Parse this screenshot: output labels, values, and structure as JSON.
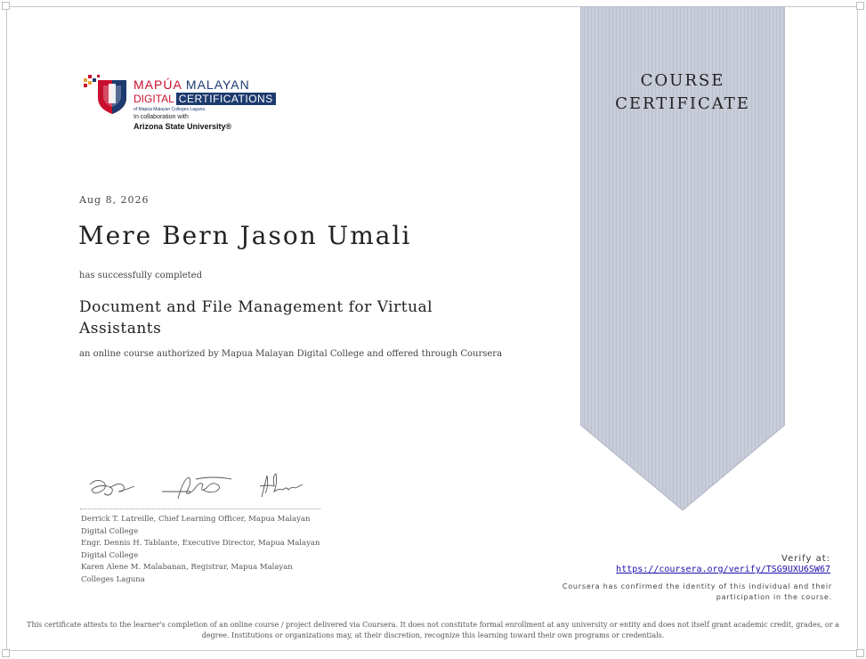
{
  "ribbon": {
    "line1": "COURSE",
    "line2": "CERTIFICATE"
  },
  "logo": {
    "name_part1": "MAPÚA",
    "name_part2": "MALAYAN",
    "digital": "DIGITAL",
    "certifications": "CERTIFICATIONS",
    "sub": "of Mapúa Malayan Colleges Laguna",
    "collab": "In collaboration with",
    "partner": "Arizona State University®"
  },
  "certificate": {
    "date": "Aug 8, 2026",
    "recipient": "Mere Bern Jason Umali",
    "completed_text": "has successfully completed",
    "course_title": "Document and File Management for Virtual Assistants",
    "authorized_text": "an online course authorized by Mapua Malayan Digital College and offered through Coursera"
  },
  "signatures": {
    "signers": [
      "Derrick T. Latreille, Chief Learning Officer, Mapua Malayan Digital College",
      "Engr. Dennis H. Tablante, Executive Director, Mapua Malayan Digital College",
      "Karen Alene M. Malabanan, Registrar, Mapua Malayan Colleges Laguna"
    ]
  },
  "verify": {
    "label": "Verify at:",
    "url": "https://coursera.org/verify/TSG9UXU6SW67",
    "confirm": "Coursera has confirmed the identity of this individual and their participation in the course."
  },
  "disclaimer": "This certificate attests to the learner's completion of an online course / project delivered via Coursera. It does not constitute formal enrollment at any university or entity and does not itself grant academic credit, grades, or a degree. Institutions or organizations may, at their discretion, recognize this learning toward their own programs or credentials.",
  "colors": {
    "ribbon": "#c8ccd8",
    "brand_red": "#c8102e",
    "brand_blue": "#1d3a6e",
    "link": "#1a0dab"
  }
}
